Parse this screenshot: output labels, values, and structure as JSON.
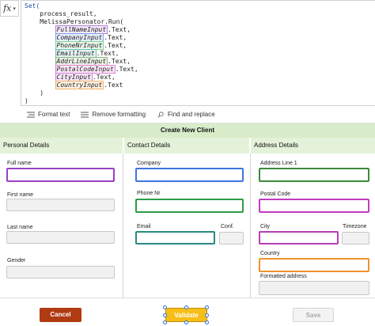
{
  "formula": {
    "fx_label": "fx",
    "lines": [
      "Set(",
      "    process_result,",
      "    MelissaPersonator.Run(",
      "        ",
      "        ",
      "        ",
      "        ",
      "        ",
      "        ",
      "        ",
      "        ",
      "    )",
      ")"
    ],
    "tokens": [
      {
        "name": "FullNameInput",
        "suffix": ".Text,",
        "color": "#b57fd6"
      },
      {
        "name": "CompanyInput",
        "suffix": ".Text,",
        "color": "#7f9ff0"
      },
      {
        "name": "PhoneNrInput",
        "suffix": ".Text,",
        "color": "#7fd68f"
      },
      {
        "name": "EmailInput",
        "suffix": ".Text,",
        "color": "#6abfb5"
      },
      {
        "name": "AddrLineInput",
        "suffix": ".Text,",
        "color": "#8ab37a"
      },
      {
        "name": "PostalCodeInput",
        "suffix": ".Text,",
        "color": "#e080d6"
      },
      {
        "name": "CityInput",
        "suffix": ".Text,",
        "color": "#d67fd9"
      },
      {
        "name": "CountryInput",
        "suffix": ".Text",
        "color": "#f2b36b"
      }
    ]
  },
  "toolbar": {
    "format_text": "Format text",
    "remove_formatting": "Remove formatting",
    "find_replace": "Find and replace"
  },
  "form": {
    "title": "Create New Client",
    "sections": {
      "personal": "Personal Details",
      "contact": "Contact Details",
      "address": "Address Details"
    },
    "labels": {
      "full_name": "Full name",
      "first_name": "First name",
      "last_name": "Last name",
      "gender": "Gender",
      "company": "Company",
      "phone": "Phone Nr",
      "email": "Email",
      "conf": "Conf.",
      "address_line": "Address Line 1",
      "postal_code": "Postal Code",
      "city": "City",
      "timezone": "Timezone",
      "country": "Country",
      "formatted_address": "Formatted address"
    }
  },
  "buttons": {
    "cancel": "Cancel",
    "validate": "Validate",
    "save": "Save"
  },
  "colors": {
    "cancel": "#b03a12",
    "validate": "#f7be1a",
    "header_green": "#d8ecc9",
    "purple": "#9b3fc4",
    "blue": "#3f74e0",
    "green": "#2f9c47",
    "teal": "#2a8a80",
    "darkgreen": "#3b8a3b",
    "magenta": "#c03cc0",
    "orange": "#f0922e"
  }
}
